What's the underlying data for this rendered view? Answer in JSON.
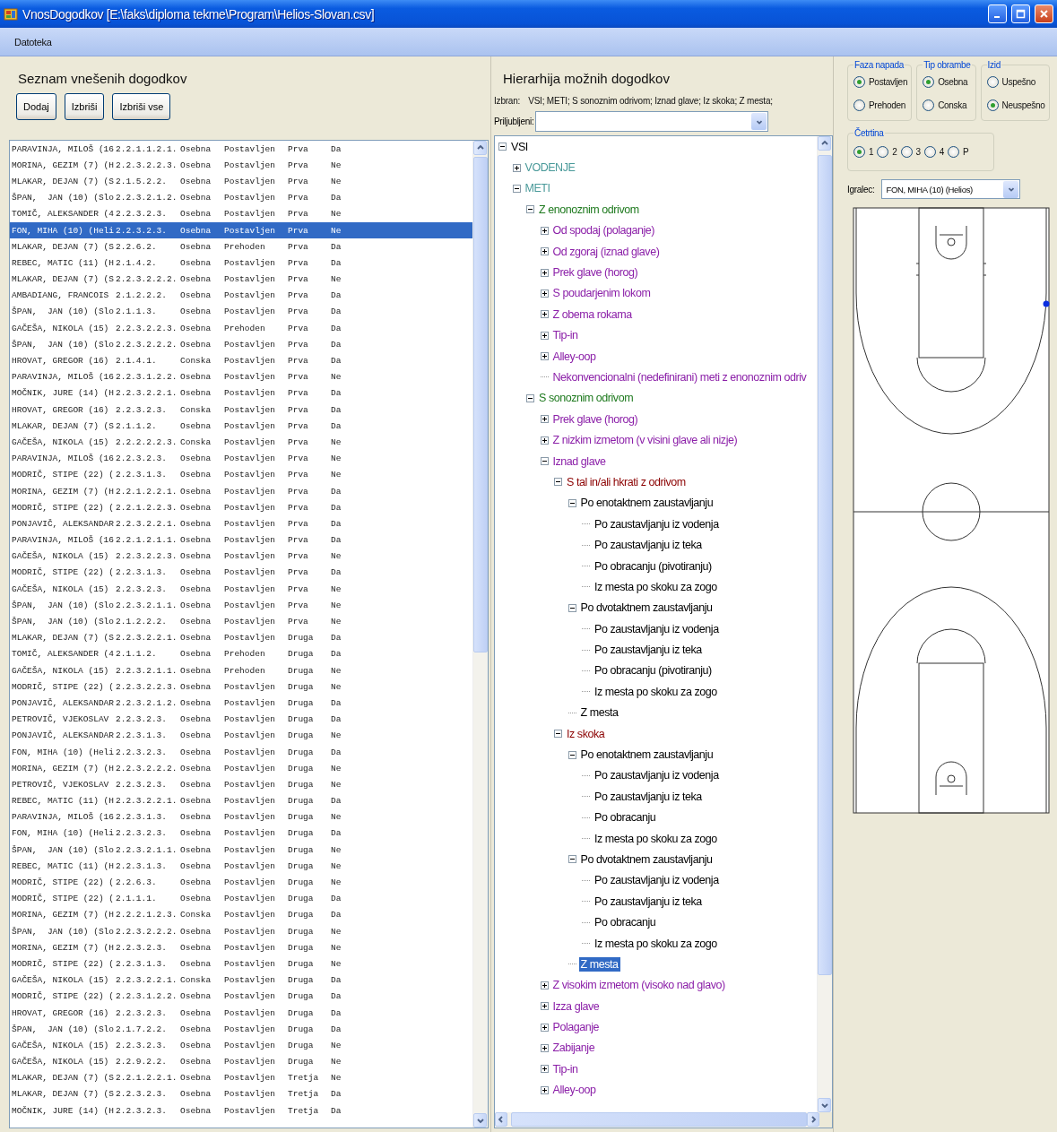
{
  "window": {
    "title": "VnosDogodkov [E:\\faks\\diploma tekme\\Program\\Helios-Slovan.csv]"
  },
  "menu": [
    "Datoteka"
  ],
  "events_panel": {
    "heading": "Seznam vnešenih dogodkov",
    "buttons": [
      "Dodaj",
      "Izbriši",
      "Izbriši vse"
    ],
    "rows": [
      {
        "cells": [
          "PARAVINJA, MILOŠ (16",
          "2.2.1.1.2.1.",
          "Osebna",
          "Postavljen",
          "Prva",
          "Da"
        ],
        "selected": false
      },
      {
        "cells": [
          "MORINA, GEZIM (7) (H",
          "2.2.3.2.2.3.",
          "Osebna",
          "Postavljen",
          "Prva",
          "Ne"
        ],
        "selected": false
      },
      {
        "cells": [
          "MLAKAR, DEJAN (7) (S",
          "2.1.5.2.2.",
          "Osebna",
          "Postavljen",
          "Prva",
          "Ne"
        ],
        "selected": false
      },
      {
        "cells": [
          "ŠPAN,  JAN (10) (Slo",
          "2.2.3.2.1.2.",
          "Osebna",
          "Postavljen",
          "Prva",
          "Da"
        ],
        "selected": false
      },
      {
        "cells": [
          "TOMIČ, ALEKSANDER (4",
          "2.2.3.2.3.",
          "Osebna",
          "Postavljen",
          "Prva",
          "Ne"
        ],
        "selected": false
      },
      {
        "cells": [
          "FON, MIHA (10) (Heli",
          "2.2.3.2.3.",
          "Osebna",
          "Postavljen",
          "Prva",
          "Ne"
        ],
        "selected": true
      },
      {
        "cells": [
          "MLAKAR, DEJAN (7) (S",
          "2.2.6.2.",
          "Osebna",
          "Prehoden",
          "Prva",
          "Da"
        ],
        "selected": false
      },
      {
        "cells": [
          "REBEC, MATIC (11) (H",
          "2.1.4.2.",
          "Osebna",
          "Postavljen",
          "Prva",
          "Da"
        ],
        "selected": false
      },
      {
        "cells": [
          "MLAKAR, DEJAN (7) (S",
          "2.2.3.2.2.2.",
          "Osebna",
          "Postavljen",
          "Prva",
          "Ne"
        ],
        "selected": false
      },
      {
        "cells": [
          "AMBADIANG, FRANCOIS",
          "2.1.2.2.2.",
          "Osebna",
          "Postavljen",
          "Prva",
          "Da"
        ],
        "selected": false
      },
      {
        "cells": [
          "ŠPAN,  JAN (10) (Slo",
          "2.1.1.3.",
          "Osebna",
          "Postavljen",
          "Prva",
          "Da"
        ],
        "selected": false
      },
      {
        "cells": [
          "GAČEŠA, NIKOLA (15)",
          "2.2.3.2.2.3.",
          "Osebna",
          "Prehoden",
          "Prva",
          "Da"
        ],
        "selected": false
      },
      {
        "cells": [
          "ŠPAN,  JAN (10) (Slo",
          "2.2.3.2.2.2.",
          "Osebna",
          "Postavljen",
          "Prva",
          "Da"
        ],
        "selected": false
      },
      {
        "cells": [
          "HROVAT, GREGOR (16)",
          "2.1.4.1.",
          "Conska",
          "Postavljen",
          "Prva",
          "Da"
        ],
        "selected": false
      },
      {
        "cells": [
          "PARAVINJA, MILOŠ (16",
          "2.2.3.1.2.2.",
          "Osebna",
          "Postavljen",
          "Prva",
          "Ne"
        ],
        "selected": false
      },
      {
        "cells": [
          "MOČNIK, JURE (14) (H",
          "2.2.3.2.2.1.",
          "Osebna",
          "Postavljen",
          "Prva",
          "Da"
        ],
        "selected": false
      },
      {
        "cells": [
          "HROVAT, GREGOR (16)",
          "2.2.3.2.3.",
          "Conska",
          "Postavljen",
          "Prva",
          "Da"
        ],
        "selected": false
      },
      {
        "cells": [
          "MLAKAR, DEJAN (7) (S",
          "2.1.1.2.",
          "Osebna",
          "Postavljen",
          "Prva",
          "Da"
        ],
        "selected": false
      },
      {
        "cells": [
          "GAČEŠA, NIKOLA (15)",
          "2.2.2.2.2.3.",
          "Conska",
          "Postavljen",
          "Prva",
          "Ne"
        ],
        "selected": false
      },
      {
        "cells": [
          "PARAVINJA, MILOŠ (16",
          "2.2.3.2.3.",
          "Osebna",
          "Postavljen",
          "Prva",
          "Ne"
        ],
        "selected": false
      },
      {
        "cells": [
          "MODRIČ, STIPE (22) (",
          "2.2.3.1.3.",
          "Osebna",
          "Postavljen",
          "Prva",
          "Ne"
        ],
        "selected": false
      },
      {
        "cells": [
          "MORINA, GEZIM (7) (H",
          "2.2.1.2.2.1.",
          "Osebna",
          "Postavljen",
          "Prva",
          "Da"
        ],
        "selected": false
      },
      {
        "cells": [
          "MODRIČ, STIPE (22) (",
          "2.2.1.2.2.3.",
          "Osebna",
          "Postavljen",
          "Prva",
          "Da"
        ],
        "selected": false
      },
      {
        "cells": [
          "PONJAVIČ, ALEKSANDAR",
          "2.2.3.2.2.1.",
          "Osebna",
          "Postavljen",
          "Prva",
          "Da"
        ],
        "selected": false
      },
      {
        "cells": [
          "PARAVINJA, MILOŠ (16",
          "2.2.1.2.1.1.",
          "Osebna",
          "Postavljen",
          "Prva",
          "Da"
        ],
        "selected": false
      },
      {
        "cells": [
          "GAČEŠA, NIKOLA (15)",
          "2.2.3.2.2.3.",
          "Osebna",
          "Postavljen",
          "Prva",
          "Ne"
        ],
        "selected": false
      },
      {
        "cells": [
          "MODRIČ, STIPE (22) (",
          "2.2.3.1.3.",
          "Osebna",
          "Postavljen",
          "Prva",
          "Da"
        ],
        "selected": false
      },
      {
        "cells": [
          "GAČEŠA, NIKOLA (15)",
          "2.2.3.2.3.",
          "Osebna",
          "Postavljen",
          "Prva",
          "Ne"
        ],
        "selected": false
      },
      {
        "cells": [
          "ŠPAN,  JAN (10) (Slo",
          "2.2.3.2.1.1.",
          "Osebna",
          "Postavljen",
          "Prva",
          "Ne"
        ],
        "selected": false
      },
      {
        "cells": [
          "ŠPAN,  JAN (10) (Slo",
          "2.1.2.2.2.",
          "Osebna",
          "Postavljen",
          "Prva",
          "Ne"
        ],
        "selected": false
      },
      {
        "cells": [
          "MLAKAR, DEJAN (7) (S",
          "2.2.3.2.2.1.",
          "Osebna",
          "Postavljen",
          "Druga",
          "Da"
        ],
        "selected": false
      },
      {
        "cells": [
          "TOMIČ, ALEKSANDER (4",
          "2.1.1.2.",
          "Osebna",
          "Prehoden",
          "Druga",
          "Da"
        ],
        "selected": false
      },
      {
        "cells": [
          "GAČEŠA, NIKOLA (15)",
          "2.2.3.2.1.1.",
          "Osebna",
          "Prehoden",
          "Druga",
          "Ne"
        ],
        "selected": false
      },
      {
        "cells": [
          "MODRIČ, STIPE (22) (",
          "2.2.3.2.2.3.",
          "Osebna",
          "Postavljen",
          "Druga",
          "Ne"
        ],
        "selected": false
      },
      {
        "cells": [
          "PONJAVIČ, ALEKSANDAR",
          "2.2.3.2.1.2.",
          "Osebna",
          "Postavljen",
          "Druga",
          "Da"
        ],
        "selected": false
      },
      {
        "cells": [
          "PETROVIČ, VJEKOSLAV",
          "2.2.3.2.3.",
          "Osebna",
          "Postavljen",
          "Druga",
          "Da"
        ],
        "selected": false
      },
      {
        "cells": [
          "PONJAVIČ, ALEKSANDAR",
          "2.2.3.1.3.",
          "Osebna",
          "Postavljen",
          "Druga",
          "Ne"
        ],
        "selected": false
      },
      {
        "cells": [
          "FON, MIHA (10) (Heli",
          "2.2.3.2.3.",
          "Osebna",
          "Postavljen",
          "Druga",
          "Da"
        ],
        "selected": false
      },
      {
        "cells": [
          "MORINA, GEZIM (7) (H",
          "2.2.3.2.2.2.",
          "Osebna",
          "Postavljen",
          "Druga",
          "Ne"
        ],
        "selected": false
      },
      {
        "cells": [
          "PETROVIČ, VJEKOSLAV",
          "2.2.3.2.3.",
          "Osebna",
          "Postavljen",
          "Druga",
          "Ne"
        ],
        "selected": false
      },
      {
        "cells": [
          "REBEC, MATIC (11) (H",
          "2.2.3.2.2.1.",
          "Osebna",
          "Postavljen",
          "Druga",
          "Da"
        ],
        "selected": false
      },
      {
        "cells": [
          "PARAVINJA, MILOŠ (16",
          "2.2.3.1.3.",
          "Osebna",
          "Postavljen",
          "Druga",
          "Ne"
        ],
        "selected": false
      },
      {
        "cells": [
          "FON, MIHA (10) (Heli",
          "2.2.3.2.3.",
          "Osebna",
          "Postavljen",
          "Druga",
          "Da"
        ],
        "selected": false
      },
      {
        "cells": [
          "ŠPAN,  JAN (10) (Slo",
          "2.2.3.2.1.1.",
          "Osebna",
          "Postavljen",
          "Druga",
          "Ne"
        ],
        "selected": false
      },
      {
        "cells": [
          "REBEC, MATIC (11) (H",
          "2.2.3.1.3.",
          "Osebna",
          "Postavljen",
          "Druga",
          "Ne"
        ],
        "selected": false
      },
      {
        "cells": [
          "MODRIČ, STIPE (22) (",
          "2.2.6.3.",
          "Osebna",
          "Postavljen",
          "Druga",
          "Ne"
        ],
        "selected": false
      },
      {
        "cells": [
          "MODRIČ, STIPE (22) (",
          "2.1.1.1.",
          "Osebna",
          "Postavljen",
          "Druga",
          "Da"
        ],
        "selected": false
      },
      {
        "cells": [
          "MORINA, GEZIM (7) (H",
          "2.2.2.1.2.3.",
          "Conska",
          "Postavljen",
          "Druga",
          "Da"
        ],
        "selected": false
      },
      {
        "cells": [
          "ŠPAN,  JAN (10) (Slo",
          "2.2.3.2.2.2.",
          "Osebna",
          "Postavljen",
          "Druga",
          "Ne"
        ],
        "selected": false
      },
      {
        "cells": [
          "MORINA, GEZIM (7) (H",
          "2.2.3.2.3.",
          "Osebna",
          "Postavljen",
          "Druga",
          "Ne"
        ],
        "selected": false
      },
      {
        "cells": [
          "MODRIČ, STIPE (22) (",
          "2.2.3.1.3.",
          "Osebna",
          "Postavljen",
          "Druga",
          "Ne"
        ],
        "selected": false
      },
      {
        "cells": [
          "GAČEŠA, NIKOLA (15)",
          "2.2.3.2.2.1.",
          "Conska",
          "Postavljen",
          "Druga",
          "Da"
        ],
        "selected": false
      },
      {
        "cells": [
          "MODRIČ, STIPE (22) (",
          "2.2.3.1.2.2.",
          "Osebna",
          "Postavljen",
          "Druga",
          "Da"
        ],
        "selected": false
      },
      {
        "cells": [
          "HROVAT, GREGOR (16)",
          "2.2.3.2.3.",
          "Osebna",
          "Postavljen",
          "Druga",
          "Da"
        ],
        "selected": false
      },
      {
        "cells": [
          "ŠPAN,  JAN (10) (Slo",
          "2.1.7.2.2.",
          "Osebna",
          "Postavljen",
          "Druga",
          "Da"
        ],
        "selected": false
      },
      {
        "cells": [
          "GAČEŠA, NIKOLA (15)",
          "2.2.3.2.3.",
          "Osebna",
          "Postavljen",
          "Druga",
          "Ne"
        ],
        "selected": false
      },
      {
        "cells": [
          "GAČEŠA, NIKOLA (15)",
          "2.2.9.2.2.",
          "Osebna",
          "Postavljen",
          "Druga",
          "Ne"
        ],
        "selected": false
      },
      {
        "cells": [
          "MLAKAR, DEJAN (7) (S",
          "2.2.1.2.2.1.",
          "Osebna",
          "Postavljen",
          "Tretja",
          "Ne"
        ],
        "selected": false
      },
      {
        "cells": [
          "MLAKAR, DEJAN (7) (S",
          "2.2.3.2.3.",
          "Osebna",
          "Postavljen",
          "Tretja",
          "Da"
        ],
        "selected": false
      },
      {
        "cells": [
          "MOČNIK, JURE (14) (H",
          "2.2.3.2.3.",
          "Osebna",
          "Postavljen",
          "Tretja",
          "Da"
        ],
        "selected": false
      }
    ]
  },
  "hierarchy_panel": {
    "heading": "Hierarhija možnih dogodkov",
    "selected_label": "Izbran:",
    "selected_path": "VSI; METI; S sonoznim odrivom; Iznad glave; Iz skoka; Z mesta;",
    "favorites_label": "Priljubljeni:",
    "tree": [
      {
        "label": "VSI",
        "expanded": true,
        "selected": false,
        "children": [
          {
            "label": "VODENJE",
            "expanded": false,
            "selected": false
          },
          {
            "label": "METI",
            "expanded": true,
            "selected": false,
            "children": [
              {
                "label": "Z enonoznim odrivom",
                "expanded": true,
                "selected": false,
                "children": [
                  {
                    "label": "Od spodaj (polaganje)",
                    "expanded": false,
                    "selected": false
                  },
                  {
                    "label": "Od zgoraj (iznad glave)",
                    "expanded": false,
                    "selected": false
                  },
                  {
                    "label": "Prek glave (horog)",
                    "expanded": false,
                    "selected": false
                  },
                  {
                    "label": "S poudarjenim lokom",
                    "expanded": false,
                    "selected": false
                  },
                  {
                    "label": "Z obema rokama",
                    "expanded": false,
                    "selected": false
                  },
                  {
                    "label": "Tip-in",
                    "expanded": false,
                    "selected": false
                  },
                  {
                    "label": "Alley-oop",
                    "expanded": false,
                    "selected": false
                  },
                  {
                    "label": "Nekonvencionalni (nedefinirani) meti z enonoznim odriv",
                    "selected": false
                  }
                ]
              },
              {
                "label": "S sonoznim odrivom",
                "expanded": true,
                "selected": false,
                "children": [
                  {
                    "label": "Prek glave (horog)",
                    "expanded": false,
                    "selected": false
                  },
                  {
                    "label": "Z nizkim izmetom (v visini glave ali nizje)",
                    "expanded": false,
                    "selected": false
                  },
                  {
                    "label": "Iznad glave",
                    "expanded": true,
                    "selected": false,
                    "children": [
                      {
                        "label": "S tal in/ali hkrati z odrivom",
                        "expanded": true,
                        "selected": false,
                        "children": [
                          {
                            "label": "Po enotaktnem zaustavljanju",
                            "expanded": true,
                            "selected": false,
                            "children": [
                              {
                                "label": "Po zaustavljanju iz vodenja",
                                "selected": false
                              },
                              {
                                "label": "Po zaustavljanju iz teka",
                                "selected": false
                              },
                              {
                                "label": "Po obracanju (pivotiranju)",
                                "selected": false
                              },
                              {
                                "label": "Iz mesta po skoku za zogo",
                                "selected": false
                              }
                            ]
                          },
                          {
                            "label": "Po dvotaktnem zaustavljanju",
                            "expanded": true,
                            "selected": false,
                            "children": [
                              {
                                "label": "Po zaustavljanju iz vodenja",
                                "selected": false
                              },
                              {
                                "label": "Po zaustavljanju iz teka",
                                "selected": false
                              },
                              {
                                "label": "Po obracanju (pivotiranju)",
                                "selected": false
                              },
                              {
                                "label": "Iz mesta po skoku za zogo",
                                "selected": false
                              }
                            ]
                          },
                          {
                            "label": "Z mesta",
                            "selected": false
                          }
                        ]
                      },
                      {
                        "label": "Iz skoka",
                        "expanded": true,
                        "selected": false,
                        "children": [
                          {
                            "label": "Po enotaktnem zaustavljanju",
                            "expanded": true,
                            "selected": false,
                            "children": [
                              {
                                "label": "Po zaustavljanju iz vodenja",
                                "selected": false
                              },
                              {
                                "label": "Po zaustavljanju iz teka",
                                "selected": false
                              },
                              {
                                "label": "Po obracanju",
                                "selected": false
                              },
                              {
                                "label": "Iz mesta po skoku za zogo",
                                "selected": false
                              }
                            ]
                          },
                          {
                            "label": "Po dvotaktnem zaustavljanju",
                            "expanded": true,
                            "selected": false,
                            "children": [
                              {
                                "label": "Po zaustavljanju iz vodenja",
                                "selected": false
                              },
                              {
                                "label": "Po zaustavljanju iz teka",
                                "selected": false
                              },
                              {
                                "label": "Po obracanju",
                                "selected": false
                              },
                              {
                                "label": "Iz mesta po skoku za zogo",
                                "selected": false
                              }
                            ]
                          },
                          {
                            "label": "Z mesta",
                            "selected": true
                          }
                        ]
                      }
                    ]
                  },
                  {
                    "label": "Z visokim izmetom (visoko nad glavo)",
                    "expanded": false,
                    "selected": false
                  },
                  {
                    "label": "Izza glave",
                    "expanded": false,
                    "selected": false
                  },
                  {
                    "label": "Polaganje",
                    "expanded": false,
                    "selected": false
                  },
                  {
                    "label": "Zabijanje",
                    "expanded": false,
                    "selected": false
                  },
                  {
                    "label": "Tip-in",
                    "expanded": false,
                    "selected": false
                  },
                  {
                    "label": "Alley-oop",
                    "expanded": false,
                    "selected": false
                  }
                ]
              }
            ]
          }
        ]
      }
    ]
  },
  "filters": {
    "groups": [
      {
        "title": "Faza napada",
        "options": [
          {
            "label": "Postavljen",
            "selected": true
          },
          {
            "label": "Prehoden",
            "selected": false
          }
        ]
      },
      {
        "title": "Tip obrambe",
        "options": [
          {
            "label": "Osebna",
            "selected": true
          },
          {
            "label": "Conska",
            "selected": false
          }
        ]
      },
      {
        "title": "Izid",
        "options": [
          {
            "label": "Uspešno",
            "selected": false
          },
          {
            "label": "Neuspešno",
            "selected": true
          }
        ]
      }
    ],
    "quarter": {
      "title": "Četrtina",
      "options": [
        {
          "label": "1",
          "selected": true
        },
        {
          "label": "2",
          "selected": false
        },
        {
          "label": "3",
          "selected": false
        },
        {
          "label": "4",
          "selected": false
        },
        {
          "label": "P",
          "selected": false
        }
      ]
    },
    "player": {
      "label": "Igralec:",
      "value": "FON, MIHA (10) (Helios)"
    }
  }
}
